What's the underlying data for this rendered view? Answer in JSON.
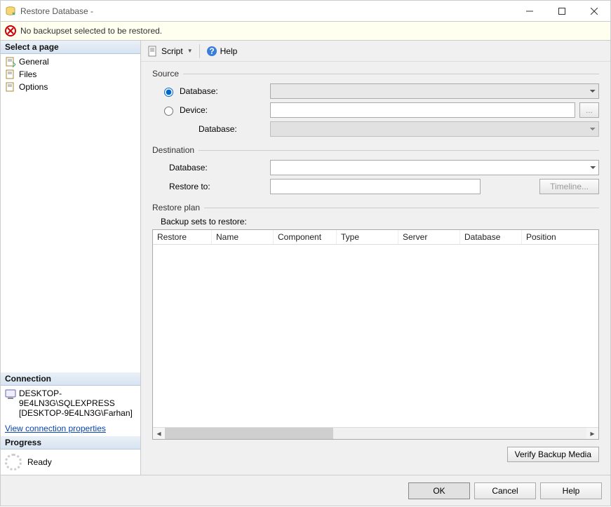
{
  "window": {
    "title": "Restore Database -"
  },
  "warning": {
    "text": "No backupset selected to be restored."
  },
  "left": {
    "select_page_header": "Select a page",
    "pages": {
      "general": "General",
      "files": "Files",
      "options": "Options"
    },
    "connection_header": "Connection",
    "connection_server": "DESKTOP-9E4LN3G\\SQLEXPRESS",
    "connection_user": "[DESKTOP-9E4LN3G\\Farhan]",
    "view_conn_props": "View connection properties",
    "progress_header": "Progress",
    "progress_status": "Ready"
  },
  "toolbar": {
    "script": "Script",
    "help": "Help"
  },
  "source": {
    "title": "Source",
    "database_radio": "Database:",
    "device_radio": "Device:",
    "device_db_label": "Database:",
    "database_value": "",
    "device_value": "",
    "device_db_value": ""
  },
  "destination": {
    "title": "Destination",
    "database_label": "Database:",
    "database_value": "",
    "restore_to_label": "Restore to:",
    "restore_to_value": "",
    "timeline_btn": "Timeline..."
  },
  "restoreplan": {
    "title": "Restore plan",
    "subtitle": "Backup sets to restore:",
    "columns": {
      "restore": "Restore",
      "name": "Name",
      "component": "Component",
      "type": "Type",
      "server": "Server",
      "database": "Database",
      "position": "Position"
    },
    "verify_btn": "Verify Backup Media"
  },
  "footer": {
    "ok": "OK",
    "cancel": "Cancel",
    "help": "Help"
  },
  "browse_btn": "..."
}
